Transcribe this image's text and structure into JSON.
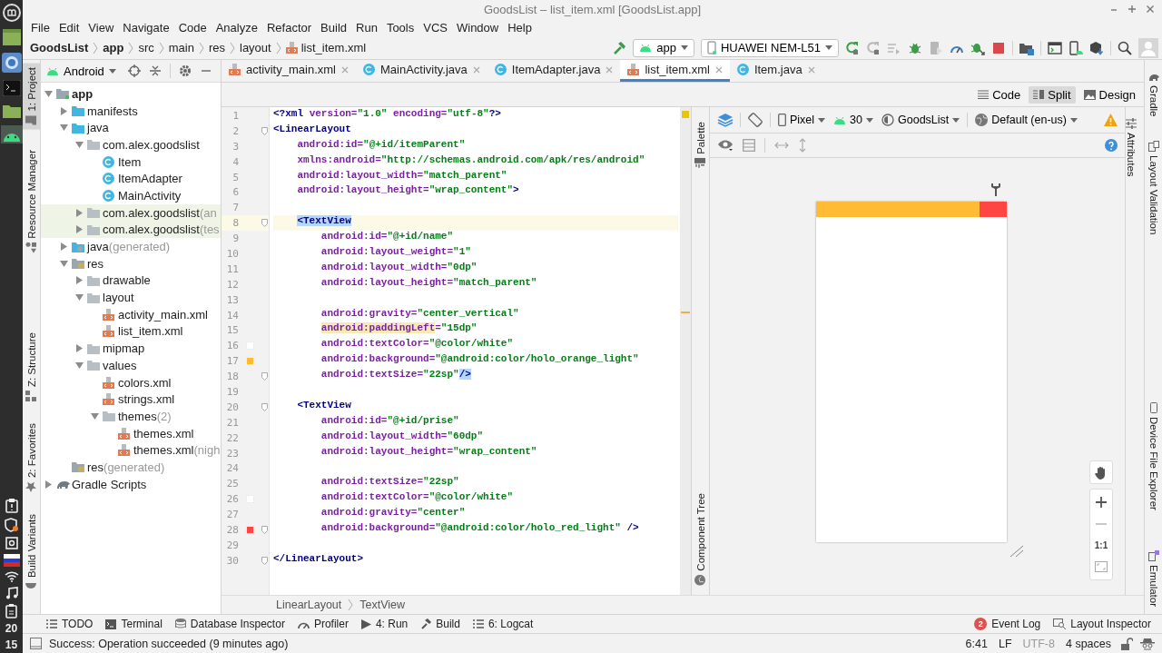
{
  "window": {
    "title": "GoodsList – list_item.xml [GoodsList.app]"
  },
  "dock": {
    "hours": "20",
    "minutes": "15"
  },
  "menu": [
    "File",
    "Edit",
    "View",
    "Navigate",
    "Code",
    "Analyze",
    "Refactor",
    "Build",
    "Run",
    "Tools",
    "VCS",
    "Window",
    "Help"
  ],
  "breadcrumbs": [
    {
      "label": "GoodsList",
      "bold": true,
      "kind": "folder"
    },
    {
      "label": "app",
      "bold": true,
      "kind": "folder"
    },
    {
      "label": "src",
      "bold": false,
      "kind": "folder"
    },
    {
      "label": "main",
      "bold": false,
      "kind": "folder"
    },
    {
      "label": "res",
      "bold": false,
      "kind": "folder"
    },
    {
      "label": "layout",
      "bold": false,
      "kind": "folder"
    },
    {
      "label": "list_item.xml",
      "bold": false,
      "kind": "xml"
    }
  ],
  "run_config": "app",
  "device": "HUAWEI NEM-L51",
  "toolbar": [
    {
      "kind": "rerun",
      "disabled": false
    },
    {
      "kind": "apply",
      "disabled": true
    },
    {
      "kind": "applycode",
      "disabled": true
    },
    {
      "kind": "debug",
      "disabled": false
    },
    {
      "kind": "attach",
      "disabled": true
    },
    {
      "kind": "profile",
      "disabled": false
    },
    {
      "kind": "debugattach",
      "disabled": false
    },
    {
      "kind": "stop",
      "disabled": false
    },
    {
      "kind": "structure",
      "disabled": false
    },
    {
      "kind": "terminal",
      "disabled": false
    },
    {
      "kind": "avd",
      "disabled": false
    },
    {
      "kind": "sdk",
      "disabled": false
    }
  ],
  "left_strip": {
    "top": [
      {
        "label": "1: Project",
        "selected": true,
        "kind": "project"
      },
      {
        "label": "Resource Manager",
        "selected": false,
        "kind": "resources"
      }
    ],
    "bottom": [
      {
        "label": "Z: Structure",
        "selected": false,
        "kind": "structure"
      },
      {
        "label": "2: Favorites",
        "selected": false,
        "kind": "favorites"
      },
      {
        "label": "Build Variants",
        "selected": false,
        "kind": "variants"
      }
    ]
  },
  "project_panel": {
    "view": "Android",
    "tree": [
      {
        "label": "app",
        "kind": "module",
        "expanded": true,
        "children": [
          {
            "label": "manifests",
            "kind": "folder",
            "expanded": false
          },
          {
            "label": "java",
            "kind": "folder",
            "expanded": true,
            "children": [
              {
                "label": "com.alex.goodslist",
                "kind": "package",
                "expanded": true,
                "highlighted": false,
                "children": [
                  {
                    "label": "Item",
                    "kind": "class"
                  },
                  {
                    "label": "ItemAdapter",
                    "kind": "class"
                  },
                  {
                    "label": "MainActivity",
                    "kind": "class"
                  }
                ]
              },
              {
                "label": "com.alex.goodslist",
                "note": "(an",
                "kind": "package",
                "expanded": false,
                "highlighted": true
              },
              {
                "label": "com.alex.goodslist",
                "note": "(tes",
                "kind": "package",
                "expanded": false,
                "highlighted": true
              }
            ]
          },
          {
            "label": "java",
            "note": "(generated)",
            "kind": "genfolder",
            "expanded": false
          },
          {
            "label": "res",
            "kind": "resfolder",
            "expanded": true,
            "children": [
              {
                "label": "drawable",
                "kind": "package",
                "expanded": false
              },
              {
                "label": "layout",
                "kind": "package",
                "expanded": true,
                "children": [
                  {
                    "label": "activity_main.xml",
                    "kind": "xml"
                  },
                  {
                    "label": "list_item.xml",
                    "kind": "xml"
                  }
                ]
              },
              {
                "label": "mipmap",
                "kind": "package",
                "expanded": false
              },
              {
                "label": "values",
                "kind": "package",
                "expanded": true,
                "children": [
                  {
                    "label": "colors.xml",
                    "kind": "xml"
                  },
                  {
                    "label": "strings.xml",
                    "kind": "xml"
                  },
                  {
                    "label": "themes",
                    "note": "(2)",
                    "kind": "package",
                    "expanded": true,
                    "children": [
                      {
                        "label": "themes.xml",
                        "kind": "xml"
                      },
                      {
                        "label": "themes.xml",
                        "note": "(nigh",
                        "kind": "xml"
                      }
                    ]
                  }
                ]
              }
            ]
          },
          {
            "label": "res",
            "note": "(generated)",
            "kind": "resfolder"
          }
        ]
      },
      {
        "label": "Gradle Scripts",
        "kind": "gradle",
        "expanded": false
      }
    ]
  },
  "editor": {
    "tabs": [
      {
        "label": "activity_main.xml",
        "kind": "xml",
        "selected": false
      },
      {
        "label": "MainActivity.java",
        "kind": "class",
        "selected": false
      },
      {
        "label": "ItemAdapter.java",
        "kind": "class",
        "selected": false
      },
      {
        "label": "list_item.xml",
        "kind": "xml",
        "selected": true
      },
      {
        "label": "Item.java",
        "kind": "class",
        "selected": false
      }
    ],
    "view_modes": [
      {
        "label": "Code",
        "kind": "code",
        "selected": false
      },
      {
        "label": "Split",
        "kind": "split",
        "selected": true
      },
      {
        "label": "Design",
        "kind": "design",
        "selected": false
      }
    ],
    "lines": [
      {
        "number": "1",
        "current": false,
        "fold": false,
        "segments": [
          {
            "kind": "tag",
            "text": "<?xml"
          },
          {
            "kind": "attr",
            "text": " version="
          },
          {
            "kind": "value",
            "text": "\"1.0\""
          },
          {
            "kind": "attr",
            "text": " encoding="
          },
          {
            "kind": "value",
            "text": "\"utf-8\""
          },
          {
            "kind": "tag",
            "text": "?>"
          }
        ]
      },
      {
        "number": "2",
        "current": false,
        "fold": true,
        "segments": [
          {
            "kind": "tag",
            "text": "<LinearLayout"
          }
        ]
      },
      {
        "number": "3",
        "current": false,
        "fold": false,
        "segments": [
          {
            "kind": "attr",
            "text": "    android:id="
          },
          {
            "kind": "value",
            "text": "\"@+id/itemParent\""
          }
        ]
      },
      {
        "number": "4",
        "current": false,
        "fold": false,
        "segments": [
          {
            "kind": "attr",
            "text": "    xmlns:android="
          },
          {
            "kind": "value",
            "text": "\"http://schemas.android.com/apk/res/android\""
          }
        ]
      },
      {
        "number": "5",
        "current": false,
        "fold": false,
        "segments": [
          {
            "kind": "attr",
            "text": "    android:layout_width="
          },
          {
            "kind": "value",
            "text": "\"match_parent\""
          }
        ]
      },
      {
        "number": "6",
        "current": false,
        "fold": false,
        "segments": [
          {
            "kind": "attr",
            "text": "    android:layout_height="
          },
          {
            "kind": "value",
            "text": "\"wrap_content\""
          },
          {
            "kind": "tag",
            "text": ">"
          }
        ]
      },
      {
        "number": "7",
        "current": false,
        "fold": false
      },
      {
        "number": "8",
        "current": true,
        "fold": true,
        "segments": [
          {
            "kind": "selection",
            "text": "    <TextView"
          }
        ]
      },
      {
        "number": "9",
        "current": false,
        "fold": false,
        "segments": [
          {
            "kind": "attr",
            "text": "        android:id="
          },
          {
            "kind": "value",
            "text": "\"@+id/name\""
          }
        ]
      },
      {
        "number": "10",
        "current": false,
        "fold": false,
        "segments": [
          {
            "kind": "attr",
            "text": "        android:layout_weight="
          },
          {
            "kind": "value",
            "text": "\"1\""
          }
        ]
      },
      {
        "number": "11",
        "current": false,
        "fold": false,
        "segments": [
          {
            "kind": "attr",
            "text": "        android:layout_width="
          },
          {
            "kind": "value",
            "text": "\"0dp\""
          }
        ]
      },
      {
        "number": "12",
        "current": false,
        "fold": false,
        "segments": [
          {
            "kind": "attr",
            "text": "        android:layout_height="
          },
          {
            "kind": "value",
            "text": "\"match_parent\""
          }
        ]
      },
      {
        "number": "13",
        "current": false,
        "fold": false
      },
      {
        "number": "14",
        "current": false,
        "fold": false,
        "segments": [
          {
            "kind": "attr",
            "text": "        android:gravity="
          },
          {
            "kind": "value",
            "text": "\"center_vertical\""
          }
        ]
      },
      {
        "number": "15",
        "current": false,
        "fold": false,
        "segments": [
          {
            "kind": "warning",
            "text": "        android:paddingLeft"
          },
          {
            "kind": "attr",
            "text": "="
          },
          {
            "kind": "value",
            "text": "\"15dp\""
          }
        ]
      },
      {
        "number": "16",
        "current": false,
        "fold": false,
        "color": "#ffffff",
        "segments": [
          {
            "kind": "attr",
            "text": "        android:textColor="
          },
          {
            "kind": "value",
            "text": "\"@color/white\""
          }
        ]
      },
      {
        "number": "17",
        "current": false,
        "fold": false,
        "color": "#ffbb33",
        "segments": [
          {
            "kind": "attr",
            "text": "        android:background="
          },
          {
            "kind": "value",
            "text": "\"@android:color/holo_orange_light\""
          }
        ]
      },
      {
        "number": "18",
        "current": false,
        "fold": true,
        "segments": [
          {
            "kind": "attr",
            "text": "        android:textSize="
          },
          {
            "kind": "value",
            "text": "\"22sp\""
          },
          {
            "kind": "selection",
            "text": "/>"
          }
        ]
      },
      {
        "number": "19",
        "current": false,
        "fold": false
      },
      {
        "number": "20",
        "current": false,
        "fold": true,
        "segments": [
          {
            "kind": "tag",
            "text": "    <TextView"
          }
        ]
      },
      {
        "number": "21",
        "current": false,
        "fold": false,
        "segments": [
          {
            "kind": "attr",
            "text": "        android:id="
          },
          {
            "kind": "value",
            "text": "\"@+id/prise\""
          }
        ]
      },
      {
        "number": "22",
        "current": false,
        "fold": false,
        "segments": [
          {
            "kind": "attr",
            "text": "        android:layout_width="
          },
          {
            "kind": "value",
            "text": "\"60dp\""
          }
        ]
      },
      {
        "number": "23",
        "current": false,
        "fold": false,
        "segments": [
          {
            "kind": "attr",
            "text": "        android:layout_height="
          },
          {
            "kind": "value",
            "text": "\"wrap_content\""
          }
        ]
      },
      {
        "number": "24",
        "current": false,
        "fold": false
      },
      {
        "number": "25",
        "current": false,
        "fold": false,
        "segments": [
          {
            "kind": "attr",
            "text": "        android:textSize="
          },
          {
            "kind": "value",
            "text": "\"22sp\""
          }
        ]
      },
      {
        "number": "26",
        "current": false,
        "fold": false,
        "color": "#ffffff",
        "segments": [
          {
            "kind": "attr",
            "text": "        android:textColor="
          },
          {
            "kind": "value",
            "text": "\"@color/white\""
          }
        ]
      },
      {
        "number": "27",
        "current": false,
        "fold": false,
        "segments": [
          {
            "kind": "attr",
            "text": "        android:gravity="
          },
          {
            "kind": "value",
            "text": "\"center\""
          }
        ]
      },
      {
        "number": "28",
        "current": false,
        "fold": true,
        "color": "#ff4444",
        "segments": [
          {
            "kind": "attr",
            "text": "        android:background="
          },
          {
            "kind": "value",
            "text": "\"@android:color/holo_red_light\""
          },
          {
            "kind": "tag",
            "text": " />"
          }
        ]
      },
      {
        "number": "29",
        "current": false,
        "fold": false
      },
      {
        "number": "30",
        "current": false,
        "fold": true,
        "segments": [
          {
            "kind": "tag",
            "text": "</LinearLayout>"
          }
        ]
      }
    ],
    "path": [
      "LinearLayout",
      "TextView"
    ]
  },
  "preview": {
    "side_tabs": [
      {
        "label": "Palette",
        "kind": "palette"
      },
      {
        "label": "Component Tree",
        "kind": "tree"
      }
    ],
    "device": "Pixel",
    "api": "30",
    "theme": "GoodsList",
    "locale": "Default (en-us)",
    "views": [
      {
        "kind": "stretch",
        "color": "#ffbb33"
      },
      {
        "kind": "fixed",
        "color": "#ff4444"
      }
    ],
    "zoom_reset": "1:1",
    "attributes_tab": "Attributes"
  },
  "right_strip": {
    "top": [
      {
        "label": "Gradle",
        "kind": "gradle"
      },
      {
        "label": "Layout Validation",
        "kind": "validation"
      }
    ],
    "bottom": [
      {
        "label": "Device File Explorer",
        "kind": "files"
      },
      {
        "label": "Emulator",
        "kind": "emulator"
      }
    ]
  },
  "bottom_tools": [
    {
      "label": "TODO",
      "kind": "todo"
    },
    {
      "label": "Terminal",
      "kind": "terminal"
    },
    {
      "label": "Database Inspector",
      "kind": "database"
    },
    {
      "label": "Profiler",
      "kind": "profiler"
    },
    {
      "label": "4: Run",
      "kind": "run"
    },
    {
      "label": "Build",
      "kind": "build"
    },
    {
      "label": "6: Logcat",
      "kind": "logcat"
    }
  ],
  "event_log": {
    "label": "Event Log",
    "badge": "2"
  },
  "layout_inspector": "Layout Inspector",
  "status": {
    "message": "Success: Operation succeeded (9 minutes ago)",
    "position": "6:41",
    "line_ending": "LF",
    "encoding": "UTF-8",
    "indent": "4 spaces"
  }
}
